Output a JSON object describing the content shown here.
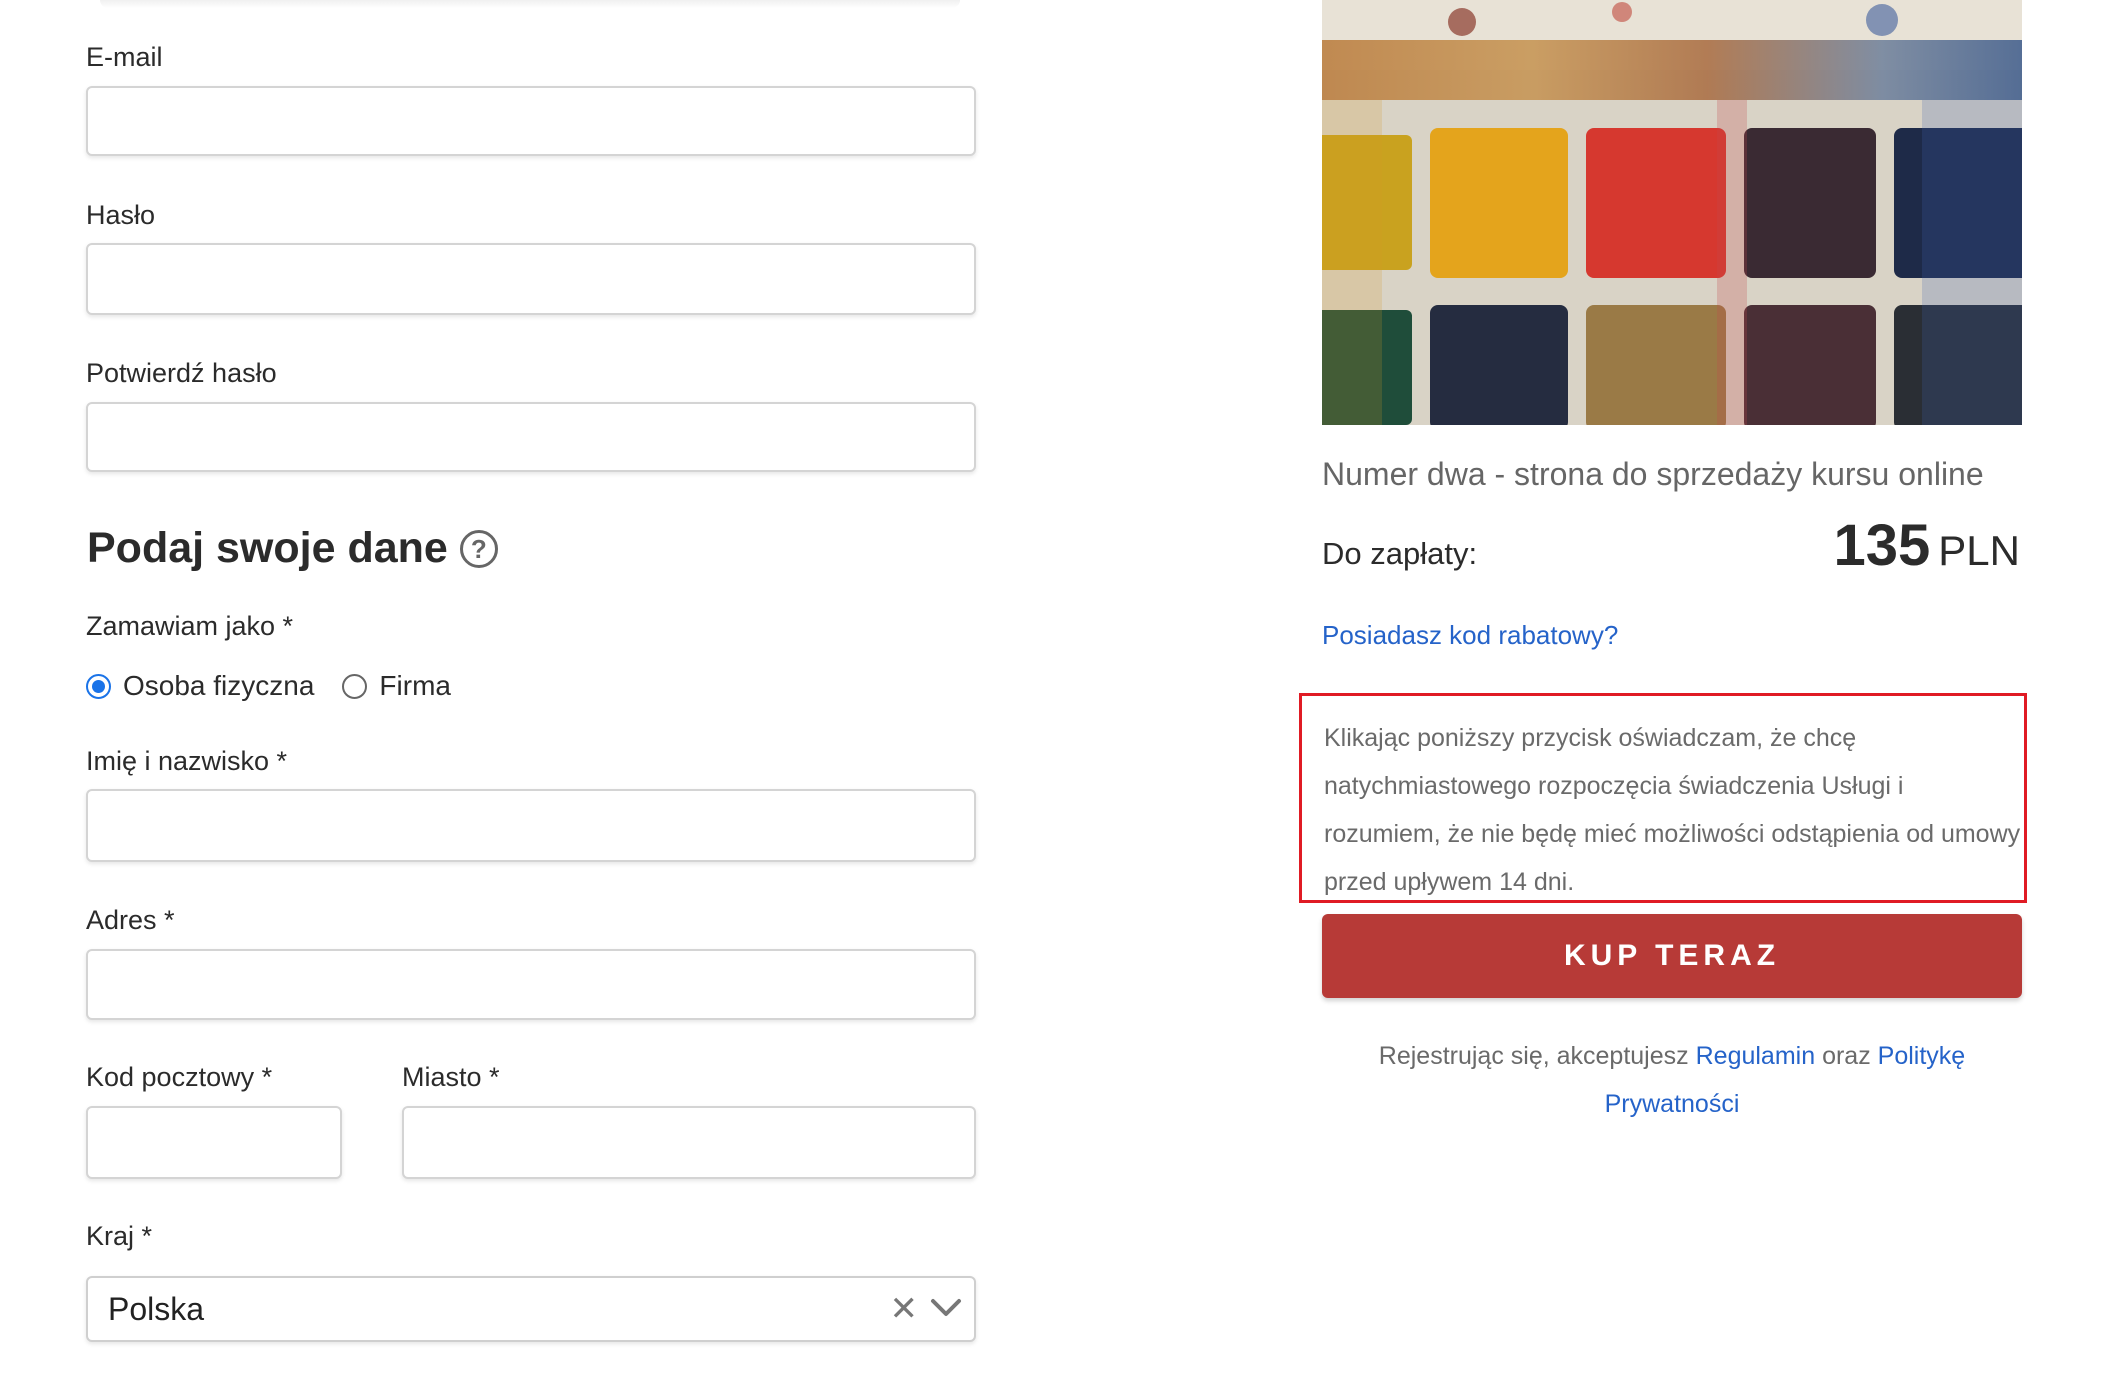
{
  "form": {
    "email_label": "E-mail",
    "password_label": "Hasło",
    "confirm_password_label": "Potwierdź hasło",
    "section_title": "Podaj swoje dane",
    "help_glyph": "?",
    "order_as_label": "Zamawiam jako *",
    "order_as_options": [
      {
        "label": "Osoba fizyczna",
        "checked": true
      },
      {
        "label": "Firma",
        "checked": false
      }
    ],
    "full_name_label": "Imię i nazwisko *",
    "address_label": "Adres *",
    "postal_code_label": "Kod pocztowy *",
    "city_label": "Miasto *",
    "country_label": "Kraj *",
    "country_value": "Polska",
    "country_clear_glyph": "✕"
  },
  "summary": {
    "product_title": "Numer dwa - strona do sprzedaży kursu online",
    "pay_label": "Do zapłaty:",
    "price_amount": "135",
    "price_currency": "PLN",
    "discount_link": "Posiadasz kod rabatowy?",
    "consent_text": "Klikając poniższy przycisk oświadczam, że chcę natychmiastowego rozpoczęcia świadczenia Usługi i rozumiem, że nie będę mieć możliwości odstąpienia od umowy przed upływem 14 dni.",
    "buy_button": "KUP TERAZ",
    "legal_prefix": "Rejestrując się, akceptujesz",
    "legal_terms_link": "Regulamin",
    "legal_middle": "oraz",
    "legal_privacy_link": "Politykę Prywatności"
  },
  "colors": {
    "accent_link": "#2563c9",
    "buy_button": "#b73a37",
    "consent_highlight": "#e01b24",
    "radio_selected": "#1a73e8"
  },
  "icons": {
    "help": "question-circle-icon",
    "clear": "close-icon",
    "dropdown": "chevron-down-icon"
  }
}
